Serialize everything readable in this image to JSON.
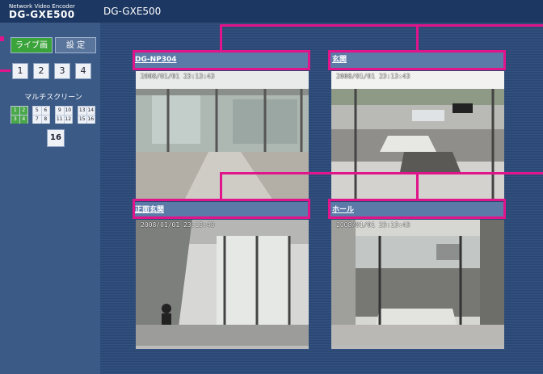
{
  "brand": {
    "subtitle": "Network Video Encoder",
    "name": "DG-GXE500"
  },
  "page_title": "DG-GXE500",
  "tabs": {
    "live": "ライブ画",
    "setup": "設 定"
  },
  "channels": [
    "1",
    "2",
    "3",
    "4"
  ],
  "multiscreen": {
    "label": "マルチスクリーン",
    "groups": [
      [
        "1",
        "2",
        "3",
        "4"
      ],
      [
        "5",
        "6",
        "7",
        "8"
      ],
      [
        "9",
        "10",
        "11",
        "12"
      ],
      [
        "13",
        "14",
        "15",
        "16"
      ]
    ],
    "sixteen_label": "16"
  },
  "cameras": [
    {
      "title": "DG-NP304",
      "timestamp": "2008/01/01 23:13:43"
    },
    {
      "title": "玄関",
      "timestamp": "2008/01/01 23:13:43"
    },
    {
      "title": "正面玄関",
      "timestamp": "2008/01/01 23:13:43"
    },
    {
      "title": "ホール",
      "timestamp": "2008/01/01 23:13:43"
    }
  ],
  "colors": {
    "highlight": "#e0158b",
    "live_tab": "#3aa33a",
    "sidebar": "#3b5a86",
    "header": "#1c3761"
  }
}
